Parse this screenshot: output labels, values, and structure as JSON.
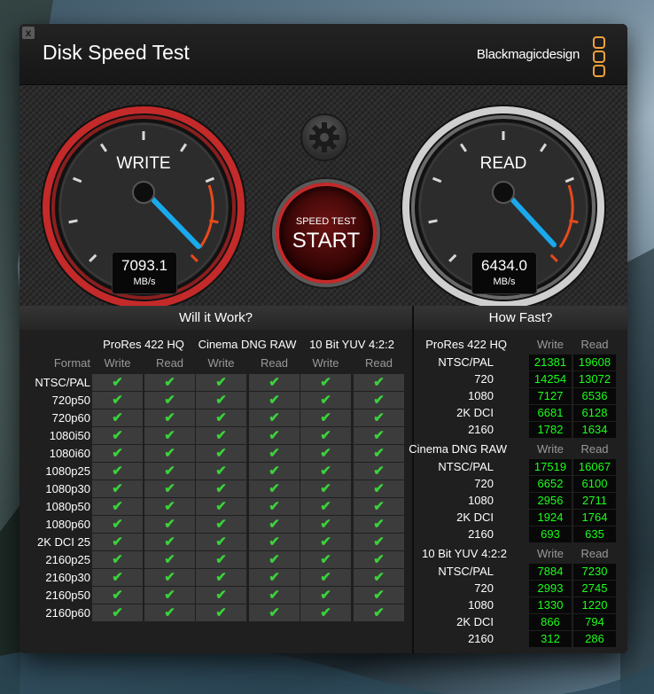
{
  "window": {
    "title": "Disk Speed Test",
    "brand": "Blackmagicdesign",
    "close": "x"
  },
  "write_gauge": {
    "label": "WRITE",
    "value": "7093.1",
    "unit": "MB/s"
  },
  "read_gauge": {
    "label": "READ",
    "value": "6434.0",
    "unit": "MB/s"
  },
  "start_button": {
    "small": "SPEED TEST",
    "big": "START"
  },
  "will_it_work": {
    "title": "Will it Work?",
    "format_header": "Format",
    "groups": [
      "ProRes 422 HQ",
      "Cinema DNG RAW",
      "10 Bit YUV 4:2:2"
    ],
    "sub": [
      "Write",
      "Read"
    ],
    "check": "✔",
    "formats": [
      "NTSC/PAL",
      "720p50",
      "720p60",
      "1080i50",
      "1080i60",
      "1080p25",
      "1080p30",
      "1080p50",
      "1080p60",
      "2K DCI 25",
      "2160p25",
      "2160p30",
      "2160p50",
      "2160p60"
    ]
  },
  "how_fast": {
    "title": "How Fast?",
    "sub": [
      "Write",
      "Read"
    ],
    "groups": [
      {
        "name": "ProRes 422 HQ",
        "rows": [
          {
            "label": "NTSC/PAL",
            "write": "21381",
            "read": "19608"
          },
          {
            "label": "720",
            "write": "14254",
            "read": "13072"
          },
          {
            "label": "1080",
            "write": "7127",
            "read": "6536"
          },
          {
            "label": "2K DCI",
            "write": "6681",
            "read": "6128"
          },
          {
            "label": "2160",
            "write": "1782",
            "read": "1634"
          }
        ]
      },
      {
        "name": "Cinema DNG RAW",
        "rows": [
          {
            "label": "NTSC/PAL",
            "write": "17519",
            "read": "16067"
          },
          {
            "label": "720",
            "write": "6652",
            "read": "6100"
          },
          {
            "label": "1080",
            "write": "2956",
            "read": "2711"
          },
          {
            "label": "2K DCI",
            "write": "1924",
            "read": "1764"
          },
          {
            "label": "2160",
            "write": "693",
            "read": "635"
          }
        ]
      },
      {
        "name": "10 Bit YUV 4:2:2",
        "rows": [
          {
            "label": "NTSC/PAL",
            "write": "7884",
            "read": "7230"
          },
          {
            "label": "720",
            "write": "2993",
            "read": "2745"
          },
          {
            "label": "1080",
            "write": "1330",
            "read": "1220"
          },
          {
            "label": "2K DCI",
            "write": "866",
            "read": "794"
          },
          {
            "label": "2160",
            "write": "312",
            "read": "286"
          }
        ]
      }
    ]
  },
  "colors": {
    "accent_orange": "#f3a13a",
    "check_green": "#3bd13b",
    "value_green": "#1bff1b",
    "needle_blue": "#19a9ec",
    "write_ring": "#c42a2a"
  }
}
